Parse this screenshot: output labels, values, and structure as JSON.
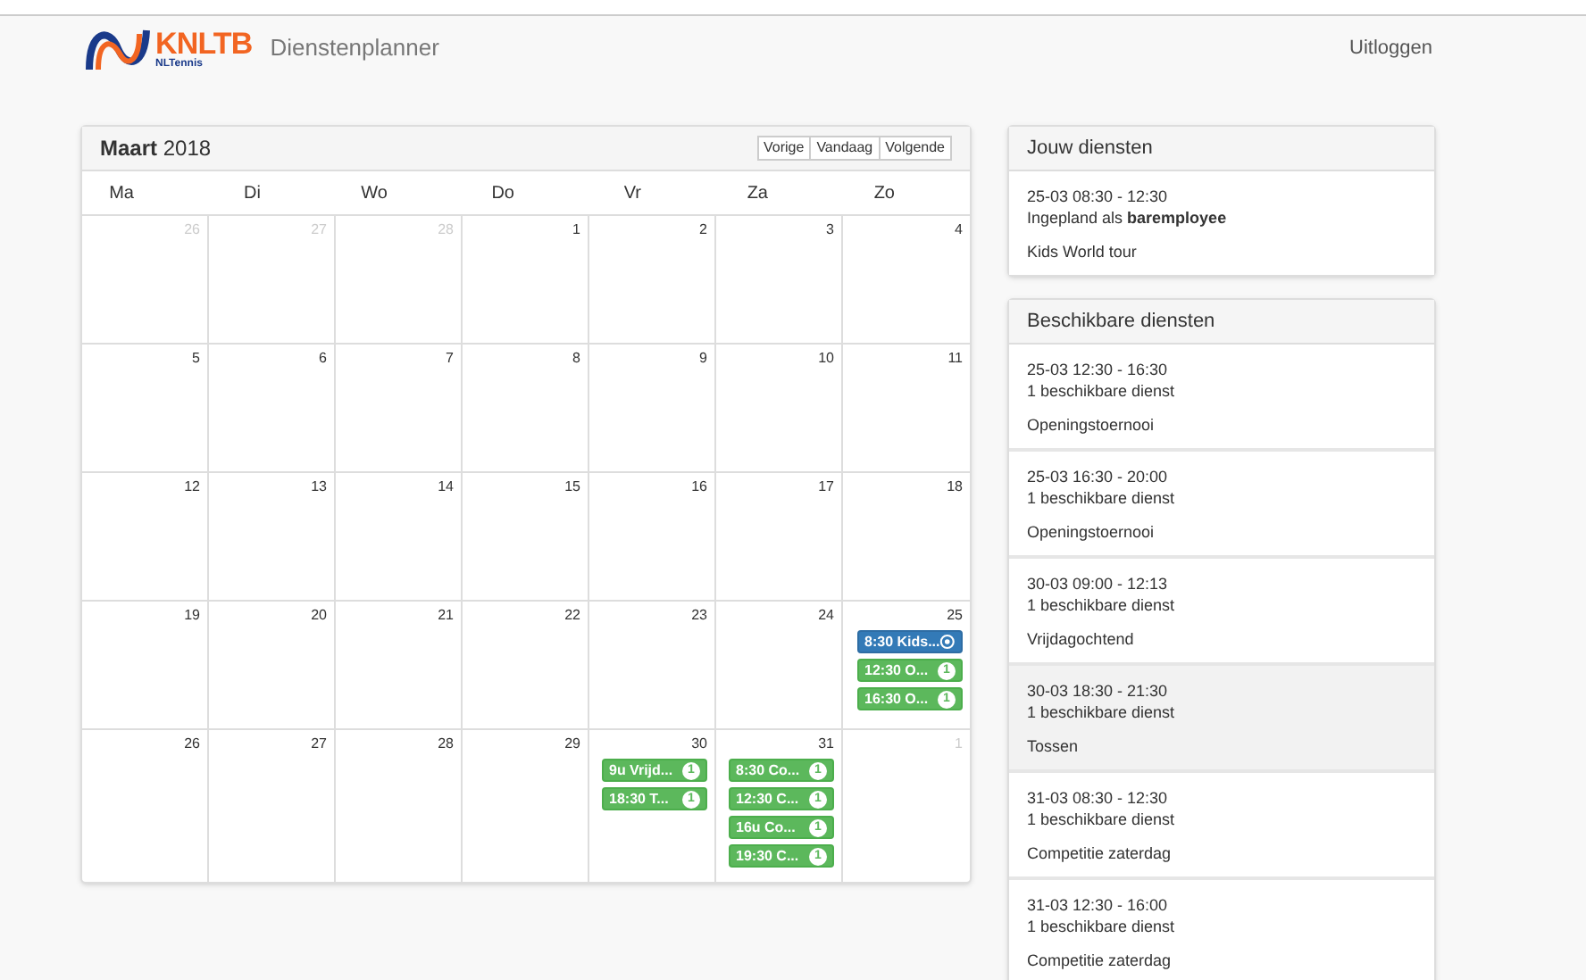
{
  "header": {
    "brand": "KNLTB",
    "brand_sub": "NLTennis",
    "app_title": "Dienstenplanner",
    "logout": "Uitloggen"
  },
  "calendar": {
    "month": "Maart",
    "year": "2018",
    "buttons": [
      "Vorige",
      "Vandaag",
      "Volgende"
    ],
    "weekdays": [
      "Ma",
      "Di",
      "Wo",
      "Do",
      "Vr",
      "Za",
      "Zo"
    ],
    "weeks": [
      {
        "days": [
          {
            "day": "26",
            "muted": true
          },
          {
            "day": "27",
            "muted": true
          },
          {
            "day": "28",
            "muted": true
          },
          {
            "day": "1",
            "muted": false
          },
          {
            "day": "2",
            "muted": false
          },
          {
            "day": "3",
            "muted": false
          },
          {
            "day": "4",
            "muted": false
          }
        ]
      },
      {
        "days": [
          {
            "day": "5",
            "muted": false
          },
          {
            "day": "6",
            "muted": false
          },
          {
            "day": "7",
            "muted": false
          },
          {
            "day": "8",
            "muted": false
          },
          {
            "day": "9",
            "muted": false
          },
          {
            "day": "10",
            "muted": false
          },
          {
            "day": "11",
            "muted": false
          }
        ]
      },
      {
        "days": [
          {
            "day": "12",
            "muted": false
          },
          {
            "day": "13",
            "muted": false
          },
          {
            "day": "14",
            "muted": false
          },
          {
            "day": "15",
            "muted": false
          },
          {
            "day": "16",
            "muted": false
          },
          {
            "day": "17",
            "muted": false
          },
          {
            "day": "18",
            "muted": false
          }
        ]
      },
      {
        "days": [
          {
            "day": "19",
            "muted": false
          },
          {
            "day": "20",
            "muted": false
          },
          {
            "day": "21",
            "muted": false
          },
          {
            "day": "22",
            "muted": false
          },
          {
            "day": "23",
            "muted": false
          },
          {
            "day": "24",
            "muted": false
          },
          {
            "day": "25",
            "muted": false,
            "events": [
              {
                "kind": "mine",
                "label": "8:30 Kids..."
              },
              {
                "kind": "available",
                "label": "12:30 O...",
                "count": "1"
              },
              {
                "kind": "available",
                "label": "16:30 O...",
                "count": "1"
              }
            ]
          }
        ]
      },
      {
        "days": [
          {
            "day": "26",
            "muted": false
          },
          {
            "day": "27",
            "muted": false
          },
          {
            "day": "28",
            "muted": false
          },
          {
            "day": "29",
            "muted": false
          },
          {
            "day": "30",
            "muted": false,
            "events": [
              {
                "kind": "available",
                "label": "9u Vrijd...",
                "count": "1"
              },
              {
                "kind": "available",
                "label": "18:30 T...",
                "count": "1"
              }
            ]
          },
          {
            "day": "31",
            "muted": false,
            "events": [
              {
                "kind": "available",
                "label": "8:30 Co...",
                "count": "1"
              },
              {
                "kind": "available",
                "label": "12:30 C...",
                "count": "1"
              },
              {
                "kind": "available",
                "label": "16u Co...",
                "count": "1"
              },
              {
                "kind": "available",
                "label": "19:30 C...",
                "count": "1"
              }
            ]
          },
          {
            "day": "1",
            "muted": true
          }
        ]
      }
    ]
  },
  "my_shifts": {
    "title": "Jouw diensten",
    "items": [
      {
        "time": "25-03 08:30 - 12:30",
        "status": "Ingepland als **baremployee**",
        "name": "Kids World tour",
        "highlighted": false
      }
    ]
  },
  "available_shifts": {
    "title": "Beschikbare diensten",
    "items": [
      {
        "time": "25-03 12:30 - 16:30",
        "status": "1 beschikbare dienst",
        "name": "Openingstoernooi",
        "highlighted": false
      },
      {
        "time": "25-03 16:30 - 20:00",
        "status": "1 beschikbare dienst",
        "name": "Openingstoernooi",
        "highlighted": false
      },
      {
        "time": "30-03 09:00 - 12:13",
        "status": "1 beschikbare dienst",
        "name": "Vrijdagochtend",
        "highlighted": false
      },
      {
        "time": "30-03 18:30 - 21:30",
        "status": "1 beschikbare dienst",
        "name": "Tossen",
        "highlighted": true
      },
      {
        "time": "31-03 08:30 - 12:30",
        "status": "1 beschikbare dienst",
        "name": "Competitie zaterdag",
        "highlighted": false
      },
      {
        "time": "31-03 12:30 - 16:00",
        "status": "1 beschikbare dienst",
        "name": "Competitie zaterdag",
        "highlighted": false
      }
    ]
  }
}
